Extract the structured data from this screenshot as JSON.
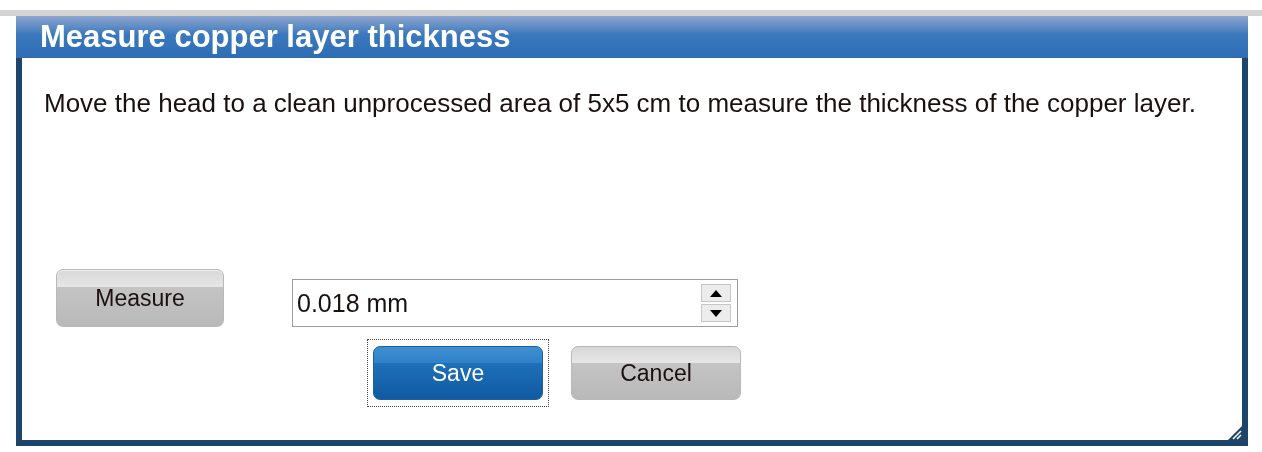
{
  "window": {
    "title": "Measure copper layer thickness"
  },
  "message": "Move the head to a clean unprocessed area of 5x5 cm to measure the thickness of the copper layer.",
  "measure_button": {
    "label": "Measure"
  },
  "thickness_field": {
    "value": "0.018 mm"
  },
  "buttons": [
    {
      "label": "Save",
      "kind": "primary",
      "focused": true
    },
    {
      "label": "Cancel",
      "kind": "secondary",
      "focused": false
    }
  ]
}
